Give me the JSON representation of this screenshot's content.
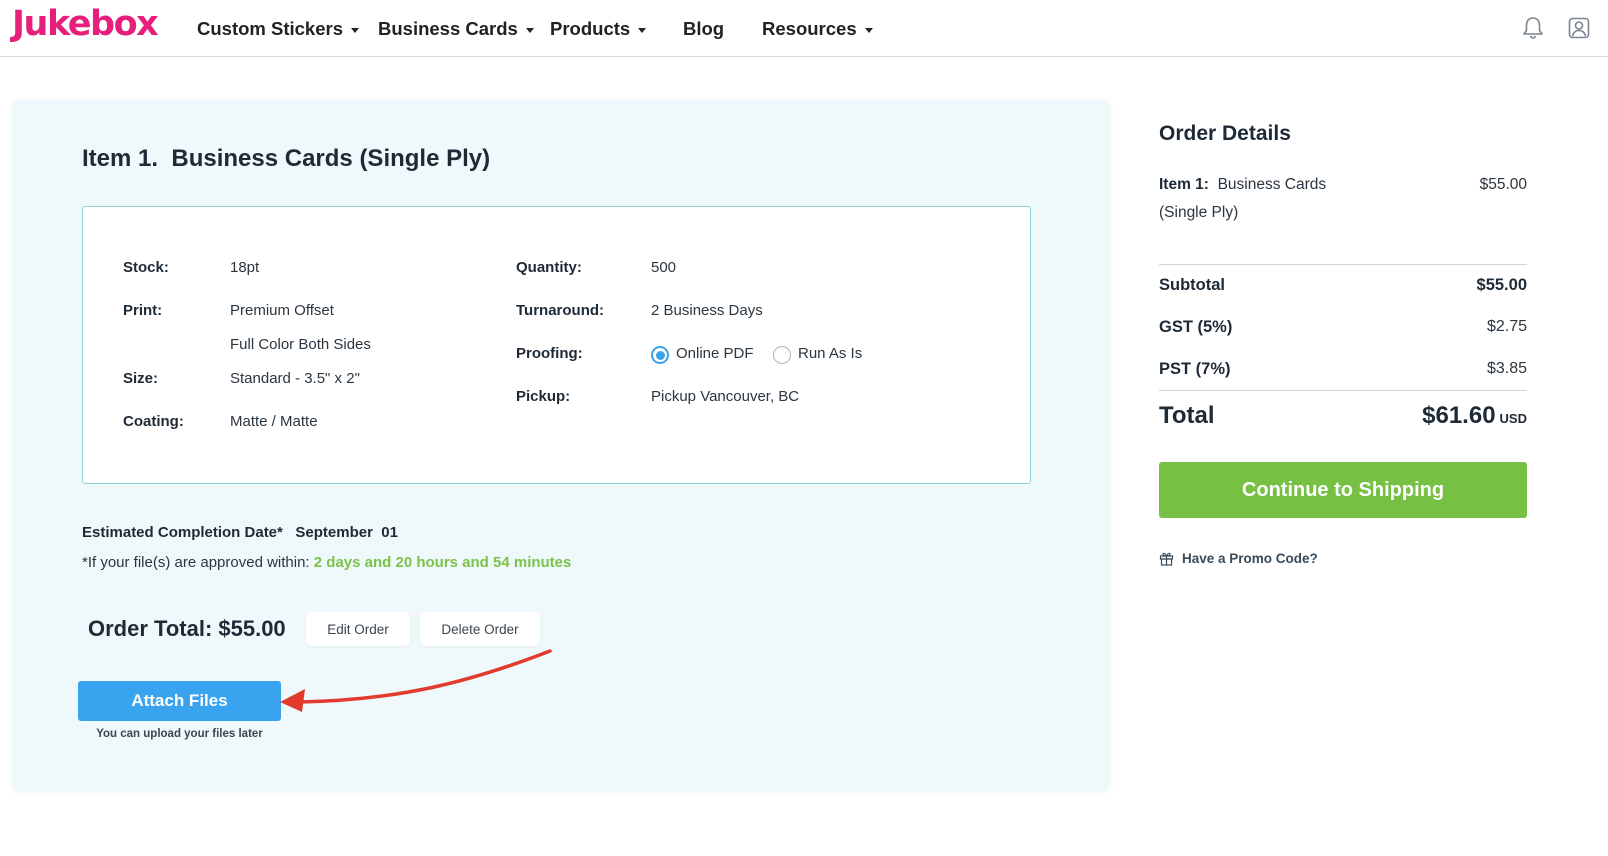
{
  "header": {
    "logo": "Jukebox",
    "nav": {
      "custom_stickers": "Custom Stickers",
      "business_cards": "Business Cards",
      "products": "Products",
      "blog": "Blog",
      "resources": "Resources"
    },
    "icons": [
      "bell-icon",
      "user-icon",
      "chevron-down-icon"
    ]
  },
  "item": {
    "title": "Item 1.  Business Cards (Single Ply)",
    "specs": {
      "stock_label": "Stock:",
      "stock": "18pt",
      "print_label": "Print:",
      "print_1": "Premium Offset",
      "print_2": "Full Color Both Sides",
      "size_label": "Size:",
      "size": "Standard - 3.5\" x 2\"",
      "coating_label": "Coating:",
      "coating": "Matte / Matte",
      "quantity_label": "Quantity:",
      "quantity": "500",
      "turnaround_label": "Turnaround:",
      "turnaround": "2 Business Days",
      "proofing_label": "Proofing:",
      "proofing_option_1": "Online PDF",
      "proofing_option_2": "Run As Is",
      "proofing_selected": "Online PDF",
      "pickup_label": "Pickup:",
      "pickup": "Pickup Vancouver, BC"
    },
    "estimated_label": "Estimated Completion Date*",
    "estimated_date": "September  01",
    "approve_note": "*If your file(s) are approved within:",
    "approve_time": "2 days and 20 hours and 54 minutes",
    "order_total": "Order Total: $55.00",
    "edit_order": "Edit Order",
    "delete_order": "Delete Order",
    "attach_files": "Attach Files",
    "attach_note": "You can upload your files later"
  },
  "order_details": {
    "title": "Order Details",
    "item_label": "Item 1:",
    "item_name": "Business Cards (Single Ply)",
    "item_price": "$55.00",
    "subtotal_label": "Subtotal",
    "subtotal": "$55.00",
    "gst_label": "GST (5%)",
    "gst": "$2.75",
    "pst_label": "PST (7%)",
    "pst": "$3.85",
    "total_label": "Total",
    "total": "$61.60",
    "currency": "USD",
    "continue_button": "Continue to Shipping",
    "promo": "Have a Promo Code?"
  },
  "colors": {
    "brand": "#e6207a",
    "panel_bg": "#eff9fc",
    "box_border": "#8ecfd0",
    "attach_blue": "#3aa3ef",
    "continue_green": "#76c043",
    "highlight_green": "#7cc24a",
    "annotation_arrow": "#e23a2c"
  }
}
